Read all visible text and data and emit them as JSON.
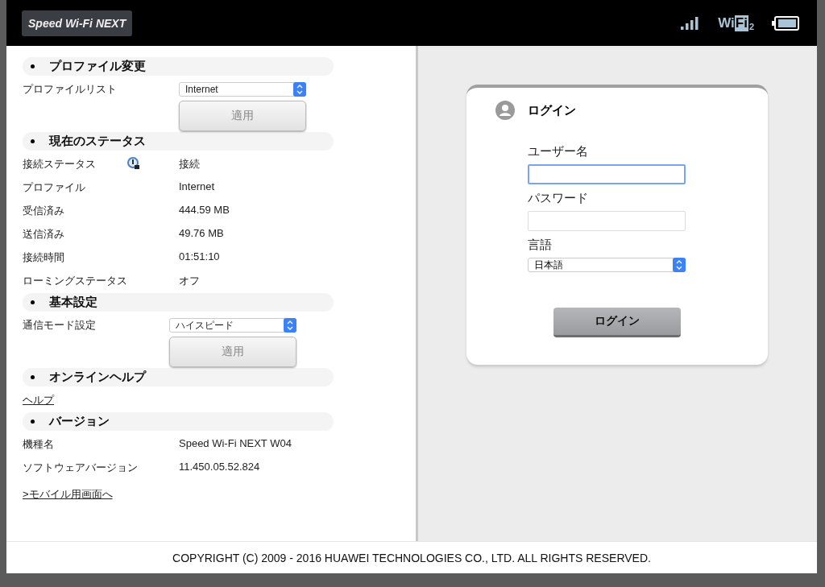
{
  "header": {
    "logo": "Speed Wi-Fi NEXT",
    "wifi": {
      "prefix": "Wi",
      "highlight": "Fi",
      "band": "2"
    }
  },
  "sections": [
    {
      "title": "プロファイル変更",
      "rows": [
        {
          "kind": "select",
          "label": "プロファイルリスト",
          "value": "Internet",
          "button": "適用"
        }
      ]
    },
    {
      "title": "現在のステータス",
      "rows": [
        {
          "kind": "info",
          "label": "接続ステータス",
          "value": "接続",
          "status_icon": true
        },
        {
          "kind": "info",
          "label": "プロファイル",
          "value": "Internet"
        },
        {
          "kind": "info",
          "label": "受信済み",
          "value": "444.59 MB"
        },
        {
          "kind": "info",
          "label": "送信済み",
          "value": "49.76 MB"
        },
        {
          "kind": "info",
          "label": "接続時間",
          "value": "01:51:10"
        },
        {
          "kind": "info",
          "label": "ローミングステータス",
          "value": "オフ"
        }
      ]
    },
    {
      "title": "基本設定",
      "rows": [
        {
          "kind": "select",
          "label": "通信モード設定",
          "value": "ハイスピード",
          "button": "適用"
        }
      ]
    },
    {
      "title": "オンラインヘルプ",
      "rows": [
        {
          "kind": "link",
          "label": "ヘルプ"
        }
      ]
    },
    {
      "title": "バージョン",
      "rows": [
        {
          "kind": "info",
          "label": "機種名",
          "value": "Speed Wi-Fi NEXT W04"
        },
        {
          "kind": "info",
          "label": "ソフトウェアバージョン",
          "value": "11.450.05.52.824"
        }
      ]
    }
  ],
  "mobile_link": ">モバイル用画面へ",
  "login": {
    "title": "ログイン",
    "fields": [
      {
        "kind": "text",
        "label": "ユーザー名",
        "focused": true
      },
      {
        "kind": "password",
        "label": "パスワード",
        "focused": false
      },
      {
        "kind": "select",
        "label": "言語",
        "value": "日本語"
      }
    ],
    "button": "ログイン"
  },
  "footer": "COPYRIGHT (C) 2009 - 2016 HUAWEI TECHNOLOGIES CO., LTD. ALL RIGHTS RESERVED."
}
